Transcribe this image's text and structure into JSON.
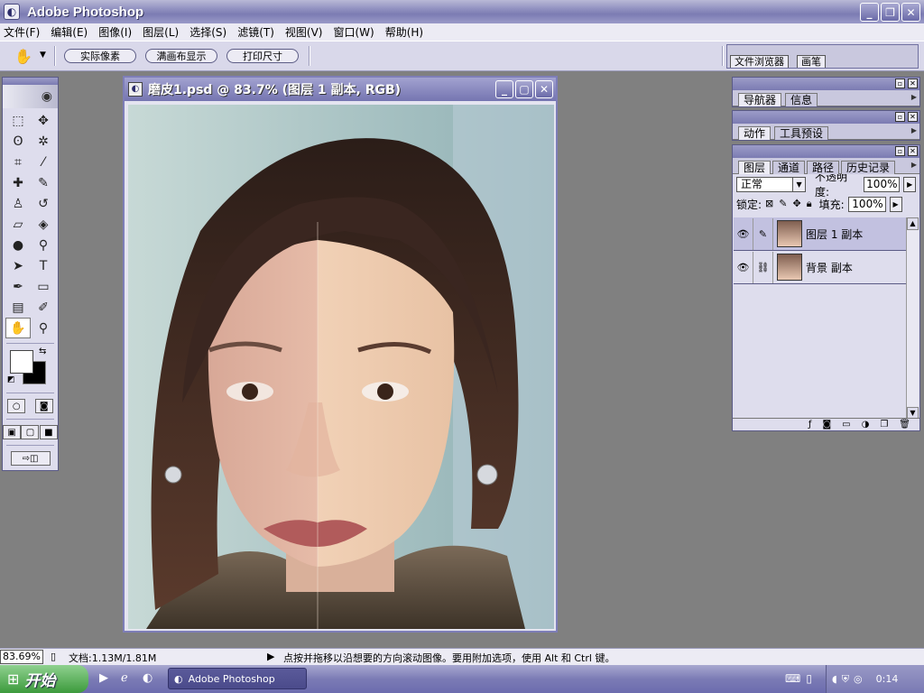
{
  "app": {
    "title": "Adobe Photoshop"
  },
  "menu": [
    "文件(F)",
    "编辑(E)",
    "图像(I)",
    "图层(L)",
    "选择(S)",
    "滤镜(T)",
    "视图(V)",
    "窗口(W)",
    "帮助(H)"
  ],
  "options": {
    "actual_pixels": "实际像素",
    "fit_on_screen": "满画布显示",
    "print_size": "打印尺寸"
  },
  "palette_well": {
    "file_browser": "文件浏览器",
    "brushes": "画笔"
  },
  "document": {
    "title": "磨皮1.psd @ 83.7% (图层 1 副本, RGB)"
  },
  "panels": {
    "navigator": {
      "tabs": [
        "导航器",
        "信息"
      ]
    },
    "actions": {
      "tabs": [
        "动作",
        "工具预设"
      ]
    },
    "layers": {
      "tabs": [
        "图层",
        "通道",
        "路径",
        "历史记录"
      ],
      "blend_mode": "正常",
      "opacity_label": "不透明度:",
      "opacity": "100%",
      "lock_label": "锁定:",
      "fill_label": "填充:",
      "fill": "100%",
      "items": [
        {
          "name": "图层 1 副本",
          "selected": true
        },
        {
          "name": "背景 副本",
          "selected": false
        }
      ]
    }
  },
  "status": {
    "zoom": "83.69%",
    "doc_size": "文档:1.13M/1.81M",
    "hint": "点按并拖移以沿想要的方向滚动图像。要用附加选项，使用 Alt 和 Ctrl 键。"
  },
  "taskbar": {
    "start": "开始",
    "task_app": "Adobe Photoshop",
    "clock": "0:14"
  }
}
